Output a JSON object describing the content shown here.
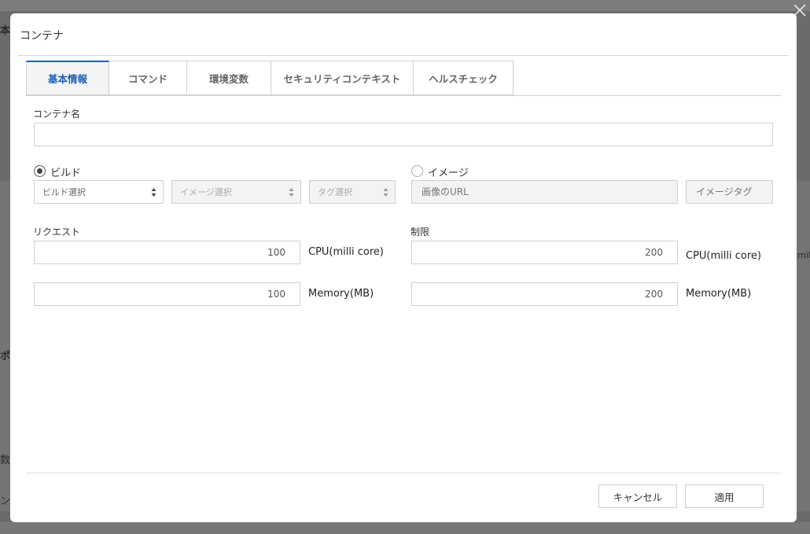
{
  "modal": {
    "title": "コンテナ",
    "tabs": [
      {
        "label": "基本情報",
        "active": true
      },
      {
        "label": "コマンド",
        "active": false
      },
      {
        "label": "環境変数",
        "active": false
      },
      {
        "label": "セキュリティコンテキスト",
        "active": false
      },
      {
        "label": "ヘルスチェック",
        "active": false
      }
    ],
    "container_name": {
      "label": "コンテナ名",
      "value": ""
    },
    "source": {
      "build": {
        "label": "ビルド",
        "checked": true,
        "build_select": "ビルド選択",
        "image_select": "イメージ選択",
        "tag_select": "タグ選択"
      },
      "image": {
        "label": "イメージ",
        "checked": false,
        "url_placeholder": "画像のURL",
        "tag_placeholder": "イメージタグ"
      }
    },
    "request": {
      "label": "リクエスト",
      "cpu_value": "100",
      "cpu_unit": "CPU(milli core)",
      "memory_value": "100",
      "memory_unit": "Memory(MB)"
    },
    "limit": {
      "label": "制限",
      "cpu_value": "200",
      "cpu_unit": "CPU(milli core)",
      "memory_value": "200",
      "memory_unit": "Memory(MB)"
    },
    "footer": {
      "cancel_label": "キャンセル",
      "apply_label": "適用"
    }
  },
  "background": {
    "fragment_1": "本",
    "fragment_2": "ポ",
    "fragment_3": "数",
    "fragment_4": "ン",
    "fragment_5": "mil"
  },
  "colors": {
    "accent": "#1f5fb0",
    "overlay": "#6b6b6b"
  }
}
